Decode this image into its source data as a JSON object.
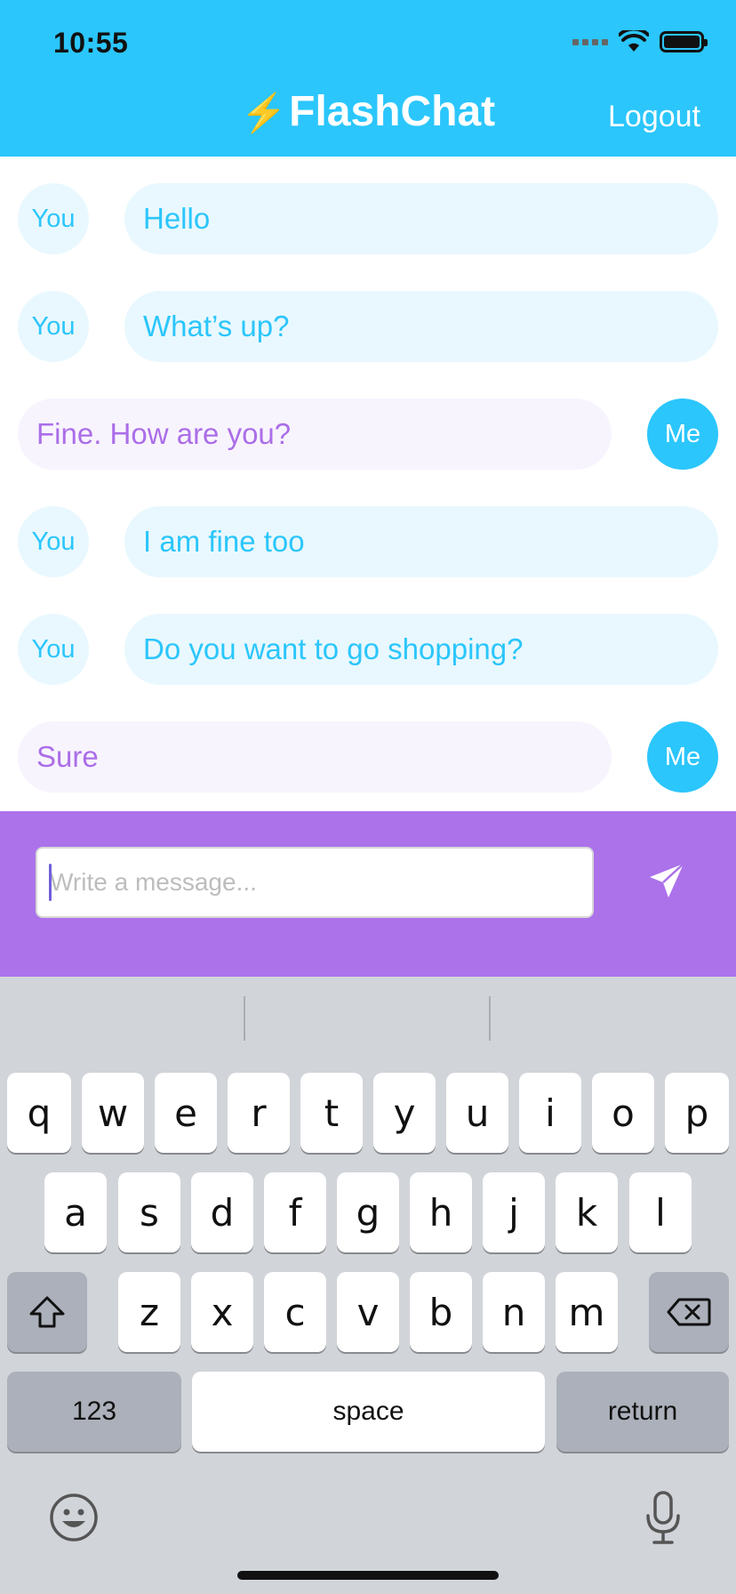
{
  "status_bar": {
    "time": "10:55"
  },
  "header": {
    "bolt": "⚡",
    "title": "FlashChat",
    "logout_label": "Logout",
    "color": "#2bc6fc"
  },
  "messages": [
    {
      "sender": "You",
      "text": "Hello"
    },
    {
      "sender": "You",
      "text": "What’s up?"
    },
    {
      "sender": "Me",
      "text": "Fine. How are you?"
    },
    {
      "sender": "You",
      "text": "I am fine too"
    },
    {
      "sender": "You",
      "text": "Do you want to go shopping?"
    },
    {
      "sender": "Me",
      "text": "Sure"
    }
  ],
  "composer": {
    "placeholder": "Write a message...",
    "value": "",
    "bar_color": "#ab72ea",
    "send_icon": "paper-plane-icon"
  },
  "keyboard": {
    "row1": [
      "q",
      "w",
      "e",
      "r",
      "t",
      "y",
      "u",
      "i",
      "o",
      "p"
    ],
    "row2": [
      "a",
      "s",
      "d",
      "f",
      "g",
      "h",
      "j",
      "k",
      "l"
    ],
    "row3": [
      "z",
      "x",
      "c",
      "v",
      "b",
      "n",
      "m"
    ],
    "shift_icon": "shift-icon",
    "delete_icon": "backspace-icon",
    "numbers_label": "123",
    "space_label": "space",
    "return_label": "return",
    "emoji_icon": "emoji-icon",
    "mic_icon": "microphone-icon"
  }
}
